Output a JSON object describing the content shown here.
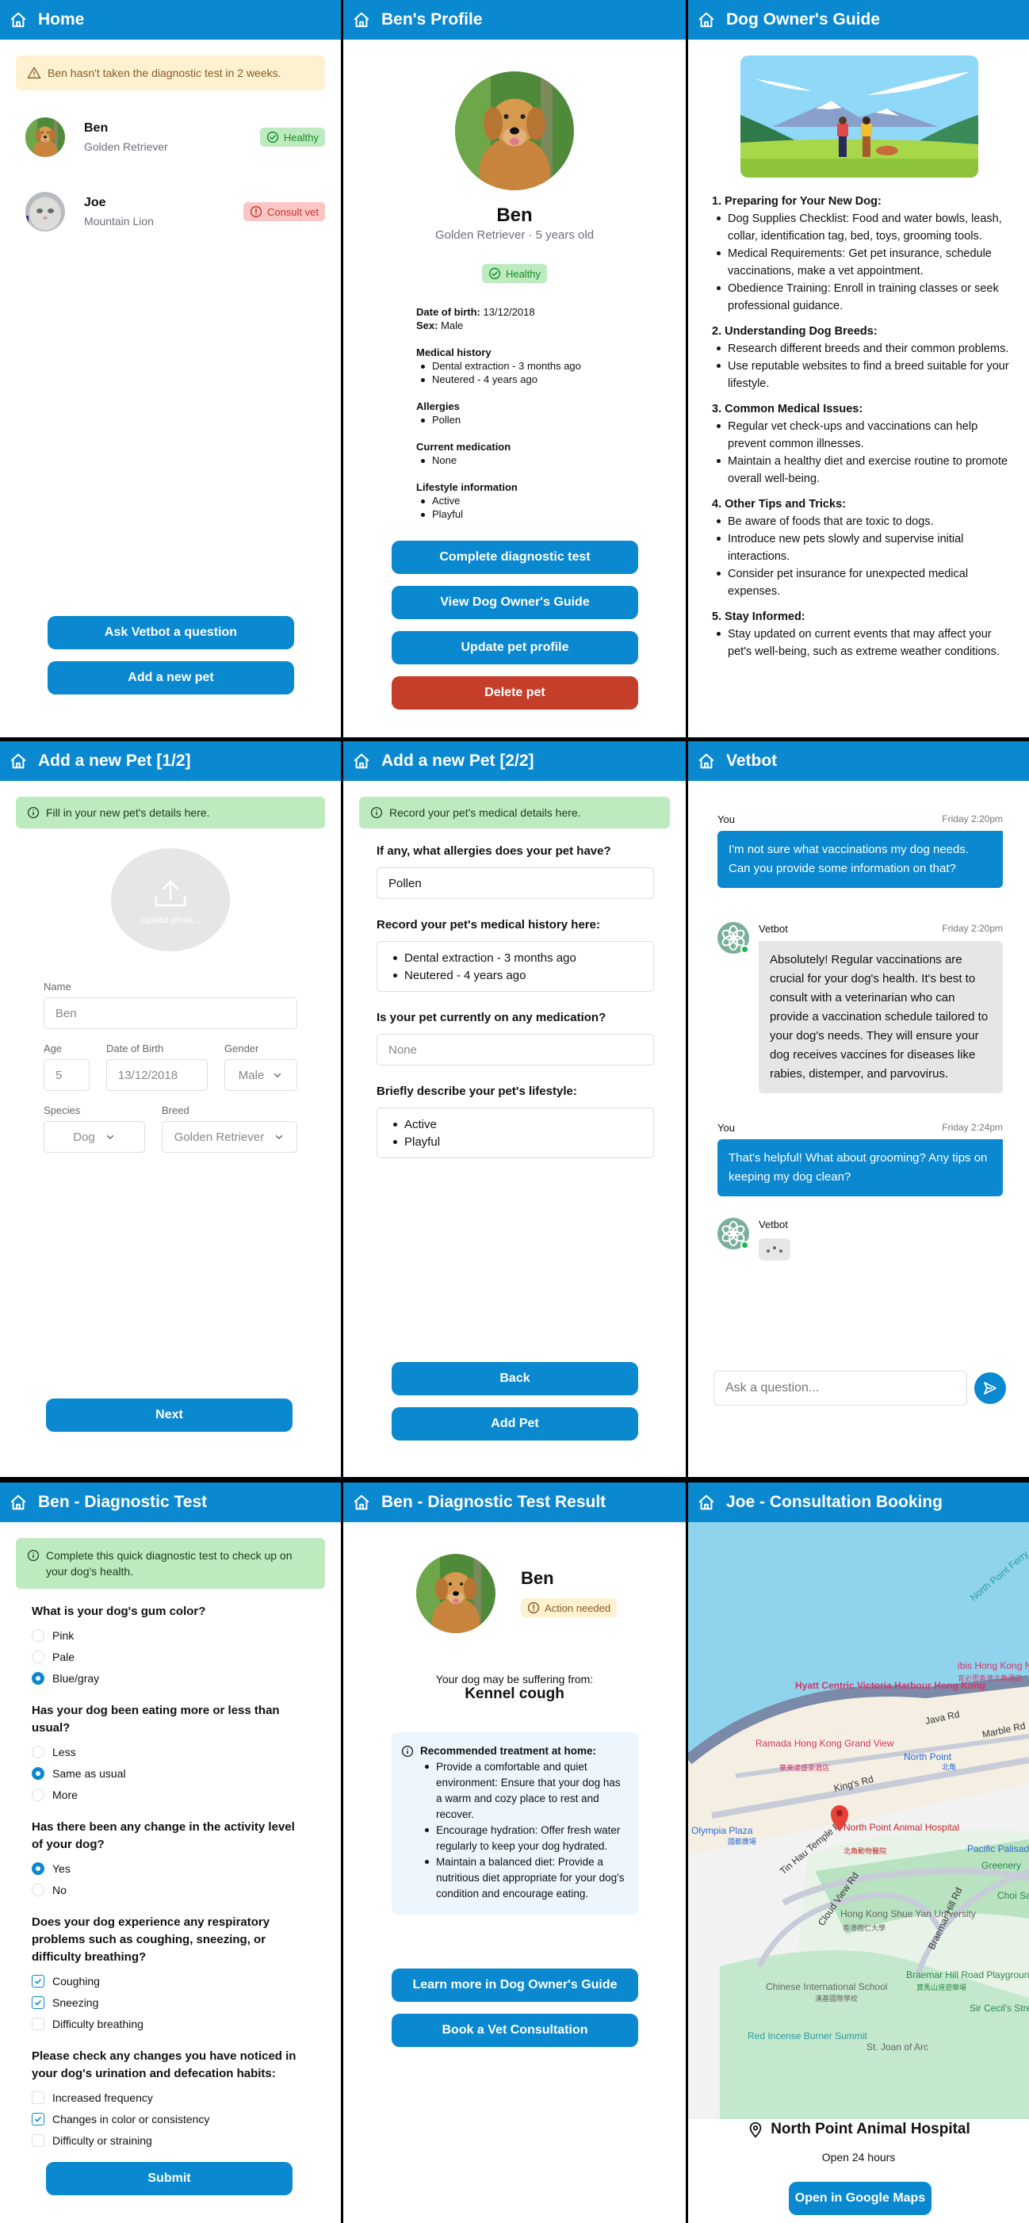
{
  "colors": {
    "primary": "#0a88d0",
    "danger": "#c43e2a",
    "success": "#1a8a2a",
    "warning_bg": "#fdf1cf",
    "info_bg": "#bdebbf"
  },
  "home": {
    "title": "Home",
    "alert": "Ben hasn't taken the diagnostic test in 2 weeks.",
    "pets": [
      {
        "name": "Ben",
        "breed": "Golden Retriever",
        "status": "Healthy",
        "status_icon": "check-circle-icon"
      },
      {
        "name": "Joe",
        "breed": "Mountain Lion",
        "status": "Consult vet",
        "status_icon": "alert-circle-icon"
      }
    ],
    "buttons": {
      "ask_vetbot": "Ask Vetbot a question",
      "add_pet": "Add a new pet"
    }
  },
  "profile": {
    "title": "Ben's Profile",
    "name": "Ben",
    "subtitle": "Golden Retriever · 5 years old",
    "status": "Healthy",
    "dob_label": "Date of birth:",
    "dob": "13/12/2018",
    "sex_label": "Sex:",
    "sex": "Male",
    "sections": [
      {
        "heading": "Medical history",
        "items": [
          "Dental extraction - 3 months ago",
          "Neutered - 4 years ago"
        ]
      },
      {
        "heading": "Allergies",
        "items": [
          "Pollen"
        ]
      },
      {
        "heading": "Current medication",
        "items": [
          "None"
        ]
      },
      {
        "heading": "Lifestyle information",
        "items": [
          "Active",
          "Playful"
        ]
      }
    ],
    "buttons": {
      "diagnostic": "Complete diagnostic test",
      "guide": "View Dog Owner's Guide",
      "update": "Update pet profile",
      "delete": "Delete pet"
    }
  },
  "guide": {
    "title": "Dog Owner's Guide",
    "sections": [
      {
        "num": "1.",
        "heading": "Preparing for Your New Dog:",
        "items": [
          "Dog Supplies Checklist: Food and water bowls, leash, collar, identification tag, bed, toys, grooming tools.",
          "Medical Requirements: Get pet insurance, schedule vaccinations, make a vet appointment.",
          "Obedience Training: Enroll in training classes or seek professional guidance."
        ]
      },
      {
        "num": "2.",
        "heading": "Understanding Dog Breeds:",
        "items": [
          "Research different breeds and their common problems.",
          "Use reputable websites to find a breed suitable for your lifestyle."
        ]
      },
      {
        "num": "3.",
        "heading": "Common Medical Issues:",
        "items": [
          "Regular vet check-ups and vaccinations can help prevent common illnesses.",
          "Maintain a healthy diet and exercise routine to promote overall well-being."
        ]
      },
      {
        "num": "4.",
        "heading": "Other Tips and Tricks:",
        "items": [
          "Be aware of foods that are toxic to dogs.",
          "Introduce new pets slowly and supervise initial interactions.",
          "Consider pet insurance for unexpected medical expenses."
        ]
      },
      {
        "num": "5.",
        "heading": "Stay Informed:",
        "items": [
          "Stay updated on current events that may affect your pet's well-being, such as extreme weather conditions."
        ]
      }
    ]
  },
  "add1": {
    "title": "Add a new Pet [1/2]",
    "alert": "Fill in your new pet's details here.",
    "upload_label": "Upload photo...",
    "fields": {
      "name": {
        "label": "Name",
        "value": "Ben"
      },
      "age": {
        "label": "Age",
        "value": "5"
      },
      "dob": {
        "label": "Date of Birth",
        "value": "13/12/2018"
      },
      "gender": {
        "label": "Gender",
        "value": "Male"
      },
      "species": {
        "label": "Species",
        "value": "Dog"
      },
      "breed": {
        "label": "Breed",
        "value": "Golden Retriever"
      }
    },
    "next": "Next"
  },
  "add2": {
    "title": "Add a new Pet [2/2]",
    "alert": "Record your pet's medical details here.",
    "q_allergies": "If any, what allergies does your pet have?",
    "allergies_value": "Pollen",
    "q_history": "Record your pet's medical history here:",
    "history_items": [
      "Dental extraction - 3 months ago",
      "Neutered - 4 years ago"
    ],
    "q_medication": "Is your pet currently on any medication?",
    "medication_placeholder": "None",
    "q_lifestyle": "Briefly describe your pet's lifestyle:",
    "lifestyle_items": [
      "Active",
      "Playful"
    ],
    "back": "Back",
    "add": "Add Pet"
  },
  "vetbot": {
    "title": "Vetbot",
    "messages": [
      {
        "sender": "You",
        "time": "Friday 2:20pm",
        "text": "I'm not sure what vaccinations my dog needs. Can you provide some information on that?"
      },
      {
        "sender": "Vetbot",
        "time": "Friday 2:20pm",
        "text": "Absolutely! Regular vaccinations are crucial for your dog's health. It's best to consult with a veterinarian who can provide a vaccination schedule tailored to your dog's needs. They will ensure your dog receives vaccines for diseases like rabies, distemper, and parvovirus."
      },
      {
        "sender": "You",
        "time": "Friday 2:24pm",
        "text": "That's helpful! What about grooming? Any tips on keeping my dog clean?"
      },
      {
        "sender": "Vetbot",
        "time": "",
        "text": ""
      }
    ],
    "input_placeholder": "Ask a question..."
  },
  "diagnostic": {
    "title": "Ben - Diagnostic Test",
    "alert": "Complete this quick diagnostic test to check up on your dog's health.",
    "questions": [
      {
        "text": "What is your dog's gum color?",
        "type": "radio",
        "options": [
          {
            "label": "Pink",
            "checked": false
          },
          {
            "label": "Pale",
            "checked": false
          },
          {
            "label": "Blue/gray",
            "checked": true
          }
        ]
      },
      {
        "text": "Has your dog been eating more or less than usual?",
        "type": "radio",
        "options": [
          {
            "label": "Less",
            "checked": false
          },
          {
            "label": "Same as usual",
            "checked": true
          },
          {
            "label": "More",
            "checked": false
          }
        ]
      },
      {
        "text": "Has there been any change in the activity level of your dog?",
        "type": "radio",
        "options": [
          {
            "label": "Yes",
            "checked": true
          },
          {
            "label": "No",
            "checked": false
          }
        ]
      },
      {
        "text": "Does your dog experience any respiratory problems such as coughing, sneezing, or difficulty breathing?",
        "type": "checkbox",
        "options": [
          {
            "label": "Coughing",
            "checked": true
          },
          {
            "label": "Sneezing",
            "checked": true
          },
          {
            "label": "Difficulty breathing",
            "checked": false
          }
        ]
      },
      {
        "text": "Please check any changes you have noticed in your dog's urination and defecation habits:",
        "type": "checkbox",
        "options": [
          {
            "label": "Increased frequency",
            "checked": false
          },
          {
            "label": "Changes in color or consistency",
            "checked": true
          },
          {
            "label": "Difficulty or straining",
            "checked": false
          }
        ]
      }
    ],
    "submit": "Submit"
  },
  "result": {
    "title": "Ben - Diagnostic Test Result",
    "name": "Ben",
    "status": "Action needed",
    "suffering_label": "Your dog may be suffering from:",
    "condition": "Kennel cough",
    "treatment_heading": "Recommended treatment at home:",
    "treatments": [
      "Provide a comfortable and quiet environment: Ensure that your dog has a warm and cozy place to rest and recover.",
      "Encourage hydration: Offer fresh water regularly to keep your dog hydrated.",
      "Maintain a balanced diet: Provide a nutritious diet appropriate for your dog's condition and encourage eating."
    ],
    "buttons": {
      "guide": "Learn more in Dog Owner's Guide",
      "book": "Book a Vet Consultation"
    }
  },
  "booking": {
    "title": "Joe - Consultation Booking",
    "map_labels": {
      "ferry": "North Point Ferry",
      "hyatt": "Hyatt Centric Victoria Harbour Hong Kong",
      "ibis": "ibis Hong Kong North Point",
      "ibis_cn": "宜必思香港北角酒店",
      "java": "Java Rd",
      "marble": "Marble Rd",
      "ramada": "Ramada Hong Kong Grand View",
      "ramada_cn": "華美達盛景酒店",
      "north_point": "North Point",
      "north_point_cn": "北角",
      "kings": "King's Rd",
      "olympia": "Olympia Plaza",
      "olympia_cn": "國都廣場",
      "hospital": "North Point Animal Hospital",
      "hospital_cn": "北角動物醫院",
      "pacific": "Pacific Palisades",
      "tinhau": "Tin Hau Temple Rd",
      "cloudview": "Cloud View Rd",
      "braemar": "Braemar Hill Rd",
      "shueyan": "Hong Kong Shue Yan University",
      "shueyan_cn": "香港樹仁大學",
      "cis": "Chinese International School",
      "cis_cn": "漢基國際學校",
      "playground": "Braemar Hill Road Playground",
      "playground_cn": "寶馬山道遊樂場",
      "greenery": "Greenery",
      "choi": "Choi Sai Woo Park",
      "cecil": "Sir Cecil's Stream Rest",
      "redincense": "Red Incense Burner Summit",
      "stjoan": "St. Joan of Arc"
    },
    "place_name": "North Point Animal Hospital",
    "hours": "Open 24 hours",
    "open_maps": "Open in Google Maps"
  }
}
